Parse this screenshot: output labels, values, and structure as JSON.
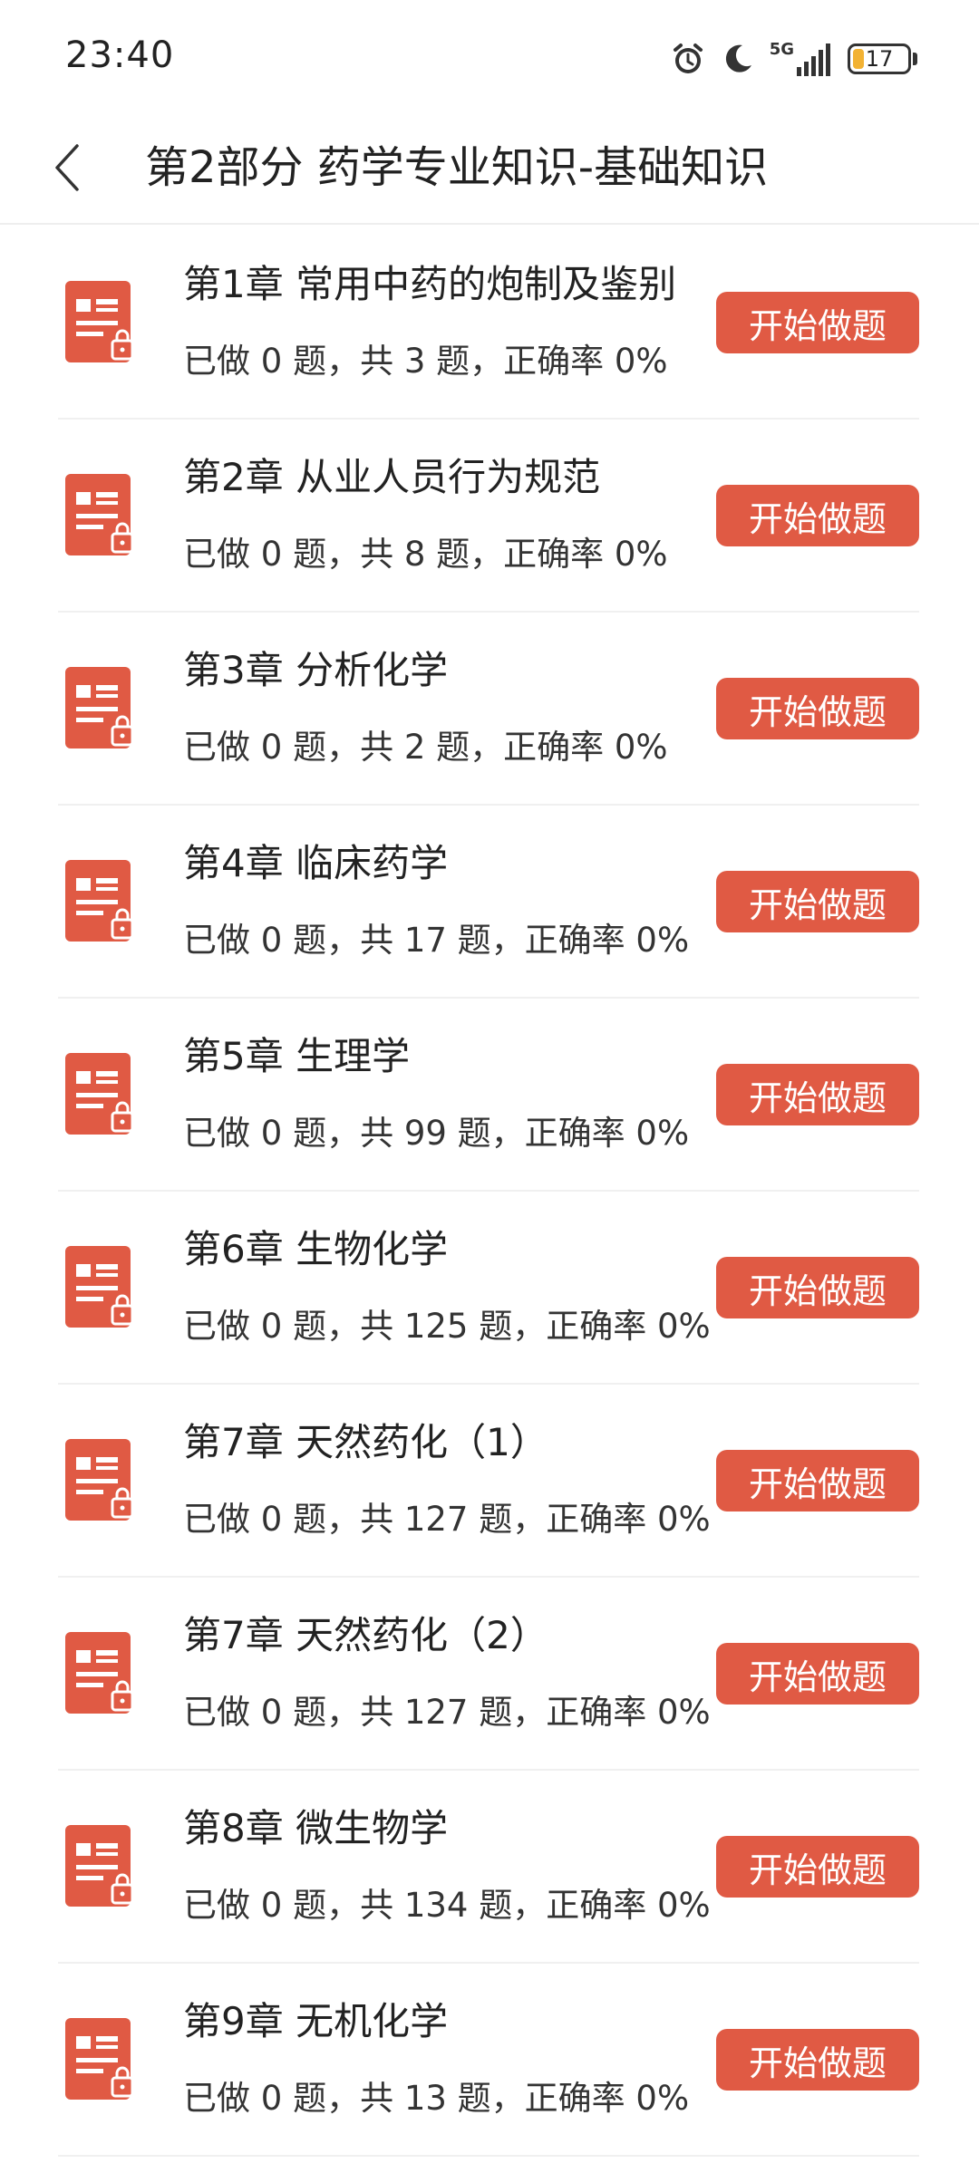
{
  "status_bar": {
    "time": "23:40",
    "network": "5G",
    "battery_level": "17",
    "icons": [
      "alarm-icon",
      "moon-icon",
      "signal-5g-icon",
      "battery-icon"
    ]
  },
  "header": {
    "title": "第2部分 药学专业知识-基础知识",
    "back_icon": "chevron-left-icon"
  },
  "colors": {
    "accent": "#e05a44",
    "battery": "#f2b233"
  },
  "chapters": [
    {
      "title": "第1章 常用中药的炮制及鉴别",
      "stats": "已做 0 题，共 3 题，正确率 0%",
      "button": "开始做题"
    },
    {
      "title": "第2章 从业人员行为规范",
      "stats": "已做 0 题，共 8 题，正确率 0%",
      "button": "开始做题"
    },
    {
      "title": "第3章 分析化学",
      "stats": "已做 0 题，共 2 题，正确率 0%",
      "button": "开始做题"
    },
    {
      "title": "第4章 临床药学",
      "stats": "已做 0 题，共 17 题，正确率 0%",
      "button": "开始做题"
    },
    {
      "title": "第5章 生理学",
      "stats": "已做 0 题，共 99 题，正确率 0%",
      "button": "开始做题"
    },
    {
      "title": "第6章 生物化学",
      "stats": "已做 0 题，共 125 题，正确率 0%",
      "button": "开始做题"
    },
    {
      "title": "第7章 天然药化（1）",
      "stats": "已做 0 题，共 127 题，正确率 0%",
      "button": "开始做题"
    },
    {
      "title": "第7章 天然药化（2）",
      "stats": "已做 0 题，共 127 题，正确率 0%",
      "button": "开始做题"
    },
    {
      "title": "第8章 微生物学",
      "stats": "已做 0 题，共 134 题，正确率 0%",
      "button": "开始做题"
    },
    {
      "title": "第9章 无机化学",
      "stats": "已做 0 题，共 13 题，正确率 0%",
      "button": "开始做题"
    }
  ]
}
